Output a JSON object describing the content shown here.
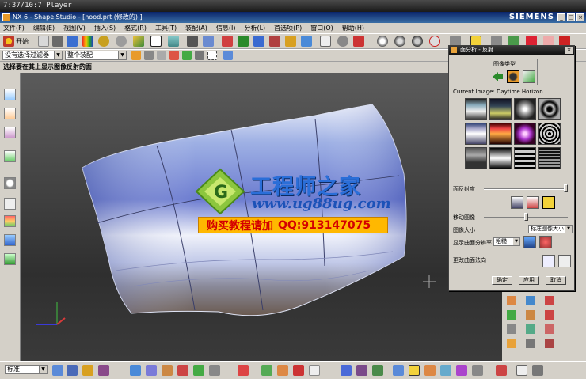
{
  "player": {
    "time": "7:37/10:7 Player"
  },
  "window": {
    "title": "NX 6 - Shape Studio - [hood.prt (修改的) ]",
    "brand": "SIEMENS"
  },
  "menu": [
    "文件(F)",
    "编辑(E)",
    "视图(V)",
    "插入(S)",
    "格式(R)",
    "工具(T)",
    "装配(A)",
    "信息(I)",
    "分析(L)",
    "首选项(P)",
    "窗口(O)",
    "帮助(H)"
  ],
  "toolbar": {
    "start_label": "开始",
    "filter_value": "没有选择过滤器",
    "assembly_value": "整个装配"
  },
  "status_prompt": "选择要在其上显示图像反射的面",
  "dialog": {
    "title": "面分析 - 反射",
    "image_type_label": "图像类型",
    "current_image": "Current Image: Daytime Horizon",
    "reflectivity_label": "面反射度",
    "move_image_label": "移动图像",
    "image_size_label": "图像大小",
    "image_size_value": "标准图像大小",
    "resolution_label": "显示曲面分辨率",
    "resolution_value": "粗糙",
    "change_direction_label": "更改曲面法向",
    "ok_label": "确定",
    "apply_label": "应用",
    "cancel_label": "取消",
    "reflectivity": 1.0,
    "move_image": 0.5
  },
  "bottom": {
    "style_value": "标准"
  },
  "watermark": {
    "title": "工程师之家",
    "url": "www.ug88ug.com",
    "banner_left": "购买教程请加",
    "banner_right": "QQ:913147075"
  }
}
